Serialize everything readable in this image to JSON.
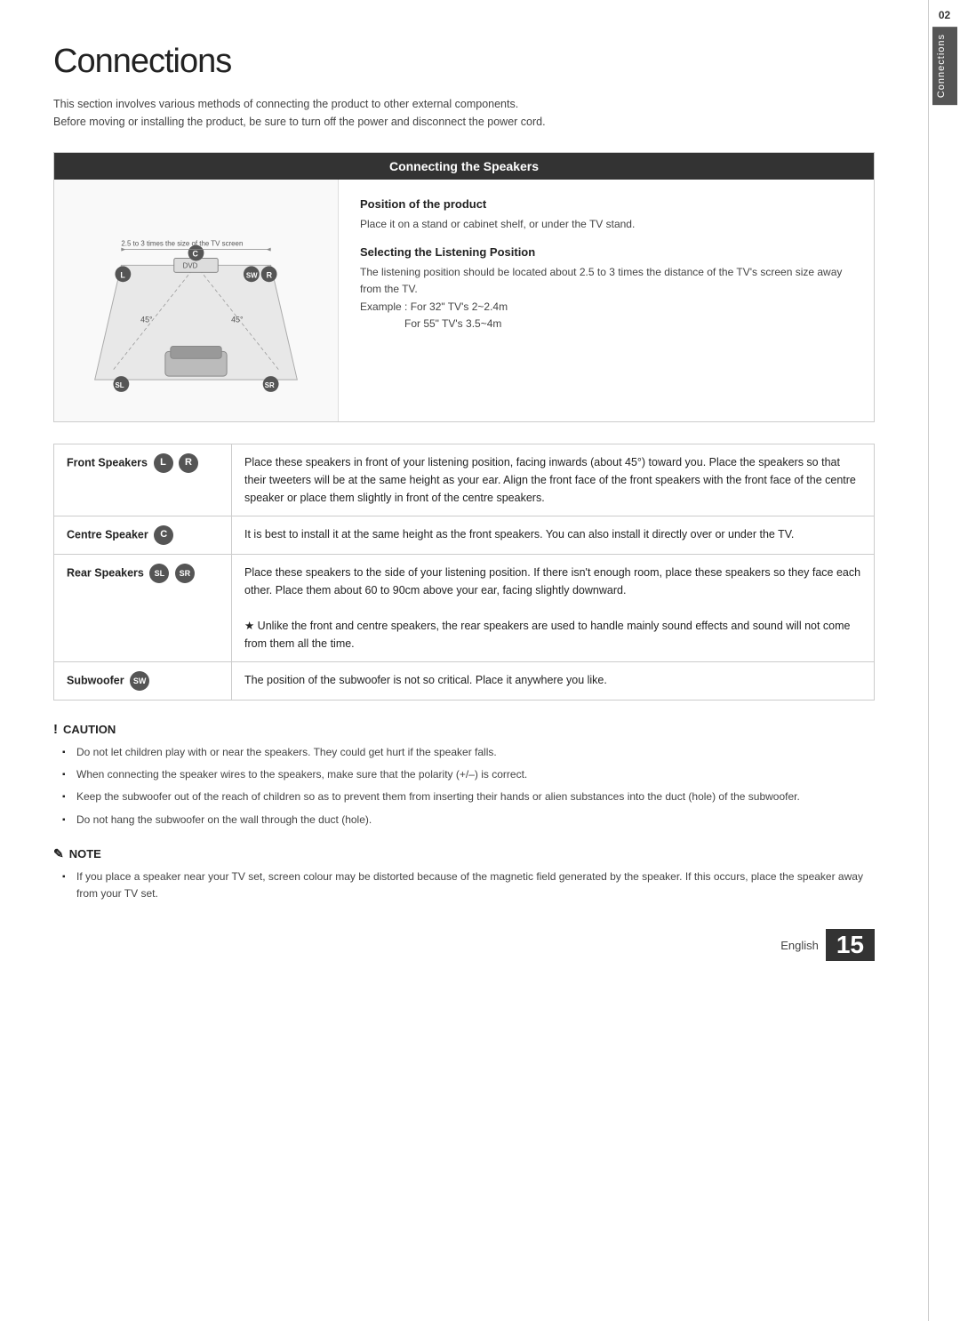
{
  "page": {
    "title": "Connections",
    "intro": [
      "This section involves various methods of connecting the product to other external components.",
      "Before moving or installing the product, be sure to turn off the power and disconnect the power cord."
    ]
  },
  "section": {
    "header": "Connecting the Speakers",
    "position_of_product": {
      "title": "Position of the product",
      "body": "Place it on a stand or cabinet shelf, or under the TV stand."
    },
    "selecting_listening": {
      "title": "Selecting the Listening Position",
      "body": "The listening position should be located about 2.5 to 3 times the distance of the TV's screen size away from the TV.",
      "examples": [
        "Example : For 32\" TV's 2~2.4m",
        "For 55\" TV's 3.5~4m"
      ]
    },
    "diagram_label": "2.5 to 3 times the size of the TV screen"
  },
  "speakers": [
    {
      "label": "Front Speakers",
      "badges": [
        "L",
        "R"
      ],
      "badge_style": "filled",
      "description": "Place these speakers in front of your listening position, facing inwards (about 45°) toward you. Place the speakers so that their tweeters will be at the same height as your ear. Align the front face of the front speakers with the front face of the centre speaker or place them slightly in front of the centre speakers."
    },
    {
      "label": "Centre Speaker",
      "badges": [
        "C"
      ],
      "badge_style": "filled",
      "description": "It is best to install it at the same height as the front speakers. You can also install it directly over or under the TV."
    },
    {
      "label": "Rear Speakers",
      "badges": [
        "SL",
        "SR"
      ],
      "badge_style": "filled",
      "description": "Place these speakers to the side of your listening position. If there isn't enough room, place these speakers so they face each other. Place them about 60 to 90cm above your ear, facing slightly downward.\n★ Unlike the front and centre speakers, the rear speakers are used to handle mainly sound effects and sound will not come from them all the time."
    },
    {
      "label": "Subwoofer",
      "badges": [
        "SW"
      ],
      "badge_style": "filled",
      "description": "The position of the subwoofer is not so critical. Place it anywhere you like."
    }
  ],
  "caution": {
    "title": "CAUTION",
    "items": [
      "Do not let children play with or near the speakers. They could get hurt if the speaker falls.",
      "When connecting the speaker wires to the speakers, make sure that the polarity (+/–) is correct.",
      "Keep the subwoofer out of the reach of children so as to prevent them from inserting their hands or alien substances into the duct (hole) of the subwoofer.",
      "Do not hang the subwoofer on the wall through the duct (hole)."
    ]
  },
  "note": {
    "title": "NOTE",
    "items": [
      "If you place a speaker near your TV set, screen colour may be distorted because of the magnetic field generated by the speaker. If this occurs, place the speaker away from your TV set."
    ]
  },
  "footer": {
    "lang": "English",
    "page_number": "15"
  },
  "side_tab": {
    "number": "02",
    "label": "Connections"
  }
}
